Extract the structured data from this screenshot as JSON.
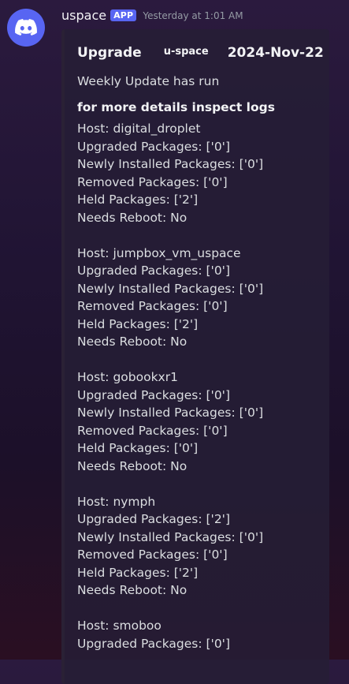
{
  "message": {
    "username": "uspace",
    "badge": "APP",
    "timestamp": "Yesterday at 1:01 AM",
    "avatar_icon": "discord-logo-icon",
    "avatar_color": "#5865f2"
  },
  "embed": {
    "title": "Upgrade",
    "author": "u-space",
    "date": "2024-Nov-22",
    "description": "Weekly Update has run",
    "field_name": "for more details inspect logs",
    "hosts": [
      {
        "host": "Host: digital_droplet",
        "upgraded": "Upgraded Packages: ['0']",
        "newly_installed": "Newly Installed Packages: ['0']",
        "removed": "Removed Packages: ['0']",
        "held": "Held Packages: ['2']",
        "reboot": "Needs Reboot: No"
      },
      {
        "host": "Host: jumpbox_vm_uspace",
        "upgraded": "Upgraded Packages: ['0']",
        "newly_installed": "Newly Installed Packages: ['0']",
        "removed": "Removed Packages: ['0']",
        "held": "Held Packages: ['2']",
        "reboot": "Needs Reboot: No"
      },
      {
        "host": "Host: gobookxr1",
        "upgraded": "Upgraded Packages: ['0']",
        "newly_installed": "Newly Installed Packages: ['0']",
        "removed": "Removed Packages: ['0']",
        "held": "Held Packages: ['0']",
        "reboot": "Needs Reboot: No"
      },
      {
        "host": "Host: nymph",
        "upgraded": "Upgraded Packages: ['2']",
        "newly_installed": "Newly Installed Packages: ['0']",
        "removed": "Removed Packages: ['0']",
        "held": "Held Packages: ['2']",
        "reboot": "Needs Reboot: No"
      },
      {
        "host": "Host: smoboo",
        "upgraded": "Upgraded Packages: ['0']",
        "newly_installed": "",
        "removed": "",
        "held": "",
        "reboot": ""
      }
    ]
  }
}
